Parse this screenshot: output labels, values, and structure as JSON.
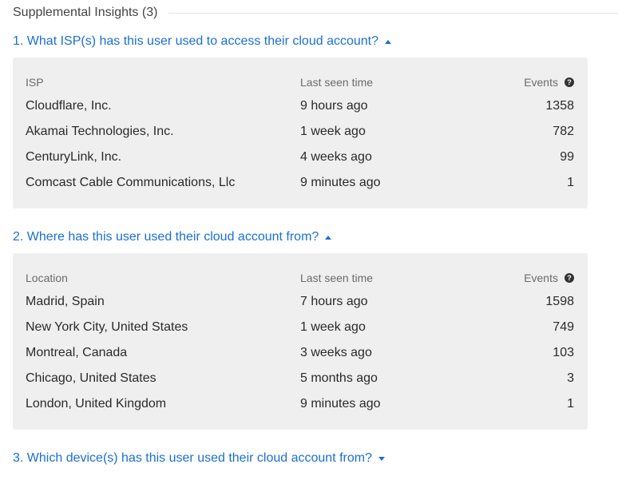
{
  "header": {
    "title": "Supplemental Insights (3)"
  },
  "questions": [
    {
      "label": "1. What ISP(s) has this user used to access their cloud account?",
      "columns": [
        "ISP",
        "Last seen time",
        "Events"
      ],
      "rows": [
        [
          "Cloudflare, Inc.",
          "9 hours ago",
          "1358"
        ],
        [
          "Akamai Technologies, Inc.",
          "1 week ago",
          "782"
        ],
        [
          "CenturyLink, Inc.",
          "4 weeks ago",
          "99"
        ],
        [
          "Comcast Cable Communications, Llc",
          "9 minutes ago",
          "1"
        ]
      ]
    },
    {
      "label": "2. Where has this user used their cloud account from?",
      "columns": [
        "Location",
        "Last seen time",
        "Events"
      ],
      "rows": [
        [
          "Madrid, Spain",
          "7 hours ago",
          "1598"
        ],
        [
          "New York City, United States",
          "1 week ago",
          "749"
        ],
        [
          "Montreal, Canada",
          "3 weeks ago",
          "103"
        ],
        [
          "Chicago, United States",
          "5 months ago",
          "3"
        ],
        [
          "London, United Kingdom",
          "9 minutes ago",
          "1"
        ]
      ]
    },
    {
      "label": "3. Which device(s) has this user used their cloud account from?"
    }
  ],
  "icons": {
    "help": "question-circle-icon",
    "expanded": "caret-up-icon",
    "collapsed": "caret-down-icon"
  },
  "colors": {
    "link": "#1a6fd6",
    "panel": "#efefef"
  }
}
